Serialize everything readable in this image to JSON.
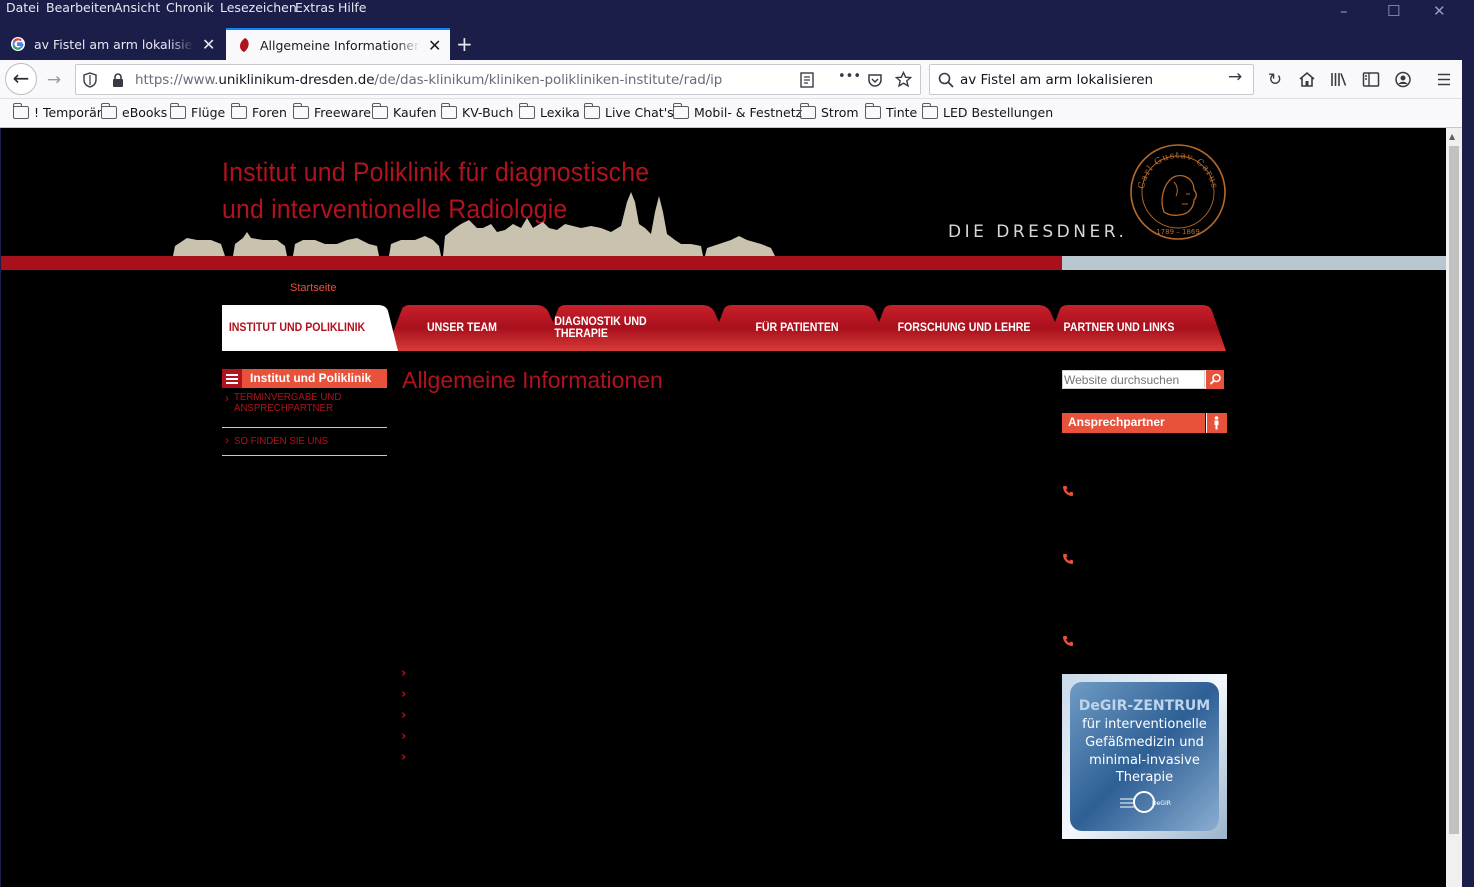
{
  "menubar": {
    "items": [
      "Datei",
      "Bearbeiten",
      "Ansicht",
      "Chronik",
      "Lesezeichen",
      "Extras",
      "Hilfe"
    ]
  },
  "tabs": [
    {
      "title": "av Fistel am arm lokalisieren - G",
      "icon": "google-icon",
      "active": false
    },
    {
      "title": "Allgemeine Informationen — D",
      "icon": "ukd-icon",
      "active": true
    }
  ],
  "toolbar": {
    "url_prefix": "https://www.",
    "url_domain": "uniklinikum-dresden.de",
    "url_path": "/de/das-klinikum/kliniken-polikliniken-institute/rad/ip",
    "search_value": "av Fistel am arm lokalisieren",
    "more_label": "•••"
  },
  "bookmarks": [
    "! Temporär",
    "eBooks",
    "Flüge",
    "Foren",
    "Freeware",
    "Kaufen",
    "KV-Buch",
    "Lexika",
    "Live Chat's",
    "Mobil- & Festnetz",
    "Strom",
    "Tinte",
    "LED Bestellungen"
  ],
  "header": {
    "title_line1": "Institut und Poliklinik für diagnostische",
    "title_line2": "und interventionelle Radiologie",
    "brand": "DIE DRESDNER.",
    "seal_text": "Carl Gustav Carus",
    "seal_years": "1789 – 1869"
  },
  "breadcrumb": "Startseite",
  "nav_tabs": [
    "INSTITUT UND POLIKLINIK",
    "UNSER TEAM",
    "DIAGNOSTIK UND THERAPIE",
    "FÜR PATIENTEN",
    "FORSCHUNG UND LEHRE",
    "PARTNER UND LINKS"
  ],
  "left_menu": {
    "title": "Institut und Poliklinik",
    "items": [
      {
        "line1": "TERMINVERGABE UND",
        "line2": "ANSPRECHPARTNER"
      },
      {
        "line1": "SO FINDEN SIE UNS",
        "line2": ""
      }
    ]
  },
  "main": {
    "title": "Allgemeine Informationen"
  },
  "sidebar": {
    "search_placeholder": "Website durchsuchen",
    "contact_title": "Ansprechpartner",
    "badge": {
      "title": "DeGIR-ZENTRUM",
      "line1": "für interventionelle",
      "line2": "Gefäßmedizin und",
      "line3": "minimal-invasive",
      "line4": "Therapie",
      "logo_text": "DeGIR"
    }
  },
  "colors": {
    "brand_red": "#b0121e",
    "accent_orange": "#e8513a",
    "frame": "#1c1e4a",
    "page_bg": "#000000"
  }
}
